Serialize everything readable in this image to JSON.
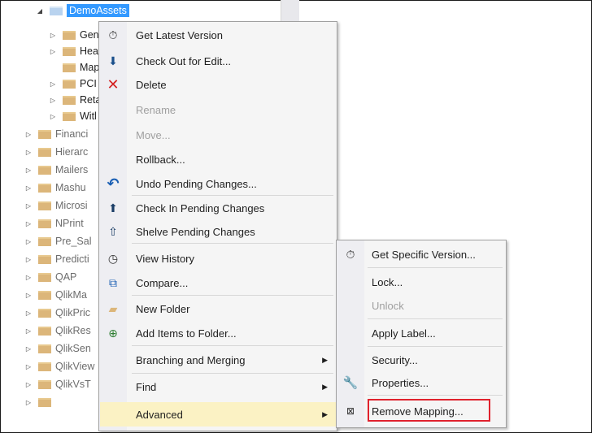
{
  "tree": {
    "root_label": "DemoAssets",
    "inner_items": [
      "Gen",
      "Hea",
      "Map",
      "PCI",
      "Reta",
      "Witl"
    ],
    "outer_items": [
      "Financi",
      "Hierarc",
      "Mailers",
      "Mashu",
      "Microsi",
      "NPrint",
      "Pre_Sal",
      "Predicti",
      "QAP",
      "QlikMa",
      "QlikPric",
      "QlikRes",
      "QlikSen",
      "QlikView",
      "QlikVsT"
    ]
  },
  "context_menu": {
    "items": [
      {
        "label": "Get Latest Version",
        "icon": "get-latest-icon"
      },
      {
        "label": "Check Out for Edit...",
        "icon": "check-out-icon"
      },
      {
        "label": "Delete",
        "icon": "delete-icon"
      },
      {
        "label": "Rename",
        "icon": ""
      },
      {
        "label": "Move...",
        "icon": ""
      },
      {
        "label": "Rollback...",
        "icon": ""
      },
      {
        "label": "Undo Pending Changes...",
        "icon": "undo-icon"
      },
      {
        "label": "Check In Pending Changes",
        "icon": "check-in-icon"
      },
      {
        "label": "Shelve Pending Changes",
        "icon": "shelve-icon"
      },
      {
        "label": "View History",
        "icon": "history-icon"
      },
      {
        "label": "Compare...",
        "icon": "compare-icon"
      },
      {
        "label": "New Folder",
        "icon": "new-folder-icon"
      },
      {
        "label": "Add Items to Folder...",
        "icon": "add-items-icon"
      },
      {
        "label": "Branching and Merging",
        "icon": ""
      },
      {
        "label": "Find",
        "icon": ""
      },
      {
        "label": "Advanced",
        "icon": ""
      }
    ]
  },
  "submenu": {
    "items": [
      {
        "label": "Get Specific Version...",
        "icon": "get-specific-icon"
      },
      {
        "label": "Lock...",
        "icon": ""
      },
      {
        "label": "Unlock",
        "icon": ""
      },
      {
        "label": "Apply Label...",
        "icon": ""
      },
      {
        "label": "Security...",
        "icon": ""
      },
      {
        "label": "Properties...",
        "icon": "wrench-icon"
      },
      {
        "label": "Remove Mapping...",
        "icon": "remove-mapping-icon"
      }
    ]
  },
  "colors": {
    "highlight": "#fbf2c4",
    "annotation_box": "#e0222d",
    "selection": "#3399ff"
  }
}
